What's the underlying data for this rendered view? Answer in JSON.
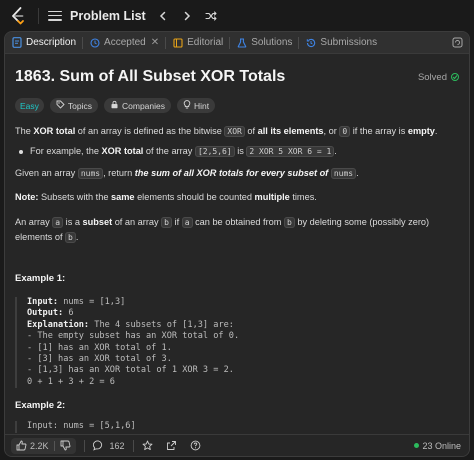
{
  "nav": {
    "title": "Problem List"
  },
  "tabs": [
    {
      "label": "Description",
      "icon": "description-icon"
    },
    {
      "label": "Accepted",
      "icon": "clock-icon"
    },
    {
      "label": "Editorial",
      "icon": "book-icon"
    },
    {
      "label": "Solutions",
      "icon": "flask-icon"
    },
    {
      "label": "Submissions",
      "icon": "history-icon"
    }
  ],
  "problem": {
    "title": "1863. Sum of All Subset XOR Totals",
    "status": "Solved",
    "badges": {
      "difficulty": "Easy",
      "topics": "Topics",
      "companies": "Companies",
      "hint": "Hint"
    }
  },
  "description": {
    "p1": {
      "t1": "The ",
      "b1": "XOR total",
      "t2": " of an array is defined as the bitwise ",
      "c1": "XOR",
      "t3": " of ",
      "b2": "all its elements",
      "t4": ", or ",
      "c2": "0",
      "t5": " if the array is ",
      "b3": "empty",
      "t6": "."
    },
    "bullet": {
      "t1": "For example, the ",
      "b1": "XOR total",
      "t2": " of the array ",
      "c1": "[2,5,6]",
      "t3": " is ",
      "c2": "2 XOR 5 XOR 6 = 1",
      "t4": "."
    },
    "p2": {
      "t1": "Given an array ",
      "c1": "nums",
      "t2": ", return ",
      "b1": "the sum of all XOR totals for every subset of",
      "c2": "nums",
      "t3": "."
    },
    "note": {
      "b1": "Note:",
      "t1": " Subsets with the ",
      "b2": "same",
      "t2": " elements should be counted ",
      "b3": "multiple",
      "t3": " times."
    },
    "p3": {
      "t1": "An array ",
      "c1": "a",
      "t2": " is a ",
      "b1": "subset",
      "t3": " of an array ",
      "c2": "b",
      "t4": " if ",
      "c3": "a",
      "t5": " can be obtained from ",
      "c4": "b",
      "t6": " by deleting some (possibly zero) elements of ",
      "c5": "b",
      "t7": "."
    }
  },
  "example1": {
    "heading": "Example 1:",
    "input_k": "Input:",
    "input_v": " nums = [1,3]",
    "output_k": "Output:",
    "output_v": " 6",
    "expl_k": "Explanation:",
    "expl_v": " The 4 subsets of [1,3] are:",
    "lines": [
      "- The empty subset has an XOR total of 0.",
      "- [1] has an XOR total of 1.",
      "- [3] has an XOR total of 3.",
      "- [1,3] has an XOR total of 1 XOR 3 = 2.",
      "0 + 1 + 3 + 2 = 6"
    ]
  },
  "example2": {
    "heading": "Example 2:",
    "partial": "Input: nums = [5,1,6]"
  },
  "bottom": {
    "likes": "2.2K",
    "comments": "162",
    "online": "23 Online"
  },
  "colors": {
    "accent_green": "#2cbb5d",
    "easy_teal": "#1ec8c8",
    "logo_orange": "#ffa116"
  }
}
